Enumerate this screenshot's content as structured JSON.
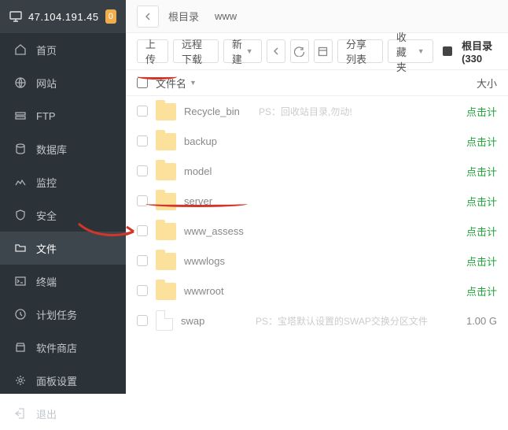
{
  "sidebar": {
    "ip": "47.104.191.45",
    "badge": "0",
    "items": [
      {
        "icon": "home",
        "label": "首页"
      },
      {
        "icon": "globe",
        "label": "网站"
      },
      {
        "icon": "ftp",
        "label": "FTP"
      },
      {
        "icon": "db",
        "label": "数据库"
      },
      {
        "icon": "monitor",
        "label": "监控"
      },
      {
        "icon": "shield",
        "label": "安全"
      },
      {
        "icon": "folder",
        "label": "文件"
      },
      {
        "icon": "terminal",
        "label": "终端"
      },
      {
        "icon": "clock",
        "label": "计划任务"
      },
      {
        "icon": "store",
        "label": "软件商店"
      },
      {
        "icon": "gear",
        "label": "面板设置"
      },
      {
        "icon": "exit",
        "label": "退出"
      }
    ],
    "activeIndex": 6
  },
  "breadcrumb": {
    "root": "根目录",
    "path": [
      "www"
    ]
  },
  "toolbar": {
    "upload": "上传",
    "remote": "远程下载",
    "new": "新建",
    "share": "分享列表",
    "fav": "收藏夹",
    "disk_label": "根目录(330"
  },
  "table": {
    "col_name": "文件名",
    "col_size": "大小",
    "click_calc": "点击计",
    "rows": [
      {
        "type": "folder",
        "name": "Recycle_bin",
        "note": "PS：回收站目录,勿动!",
        "size": "点击计"
      },
      {
        "type": "folder",
        "name": "backup",
        "note": "",
        "size": "点击计"
      },
      {
        "type": "folder",
        "name": "model",
        "note": "",
        "size": "点击计"
      },
      {
        "type": "folder",
        "name": "server",
        "note": "",
        "size": "点击计"
      },
      {
        "type": "folder",
        "name": "www_assess",
        "note": "",
        "size": "点击计"
      },
      {
        "type": "folder",
        "name": "wwwlogs",
        "note": "",
        "size": "点击计"
      },
      {
        "type": "folder",
        "name": "wwwroot",
        "note": "",
        "size": "点击计"
      },
      {
        "type": "file",
        "name": "swap",
        "note": "PS：宝塔默认设置的SWAP交换分区文件",
        "size": "1.00 G"
      }
    ]
  }
}
